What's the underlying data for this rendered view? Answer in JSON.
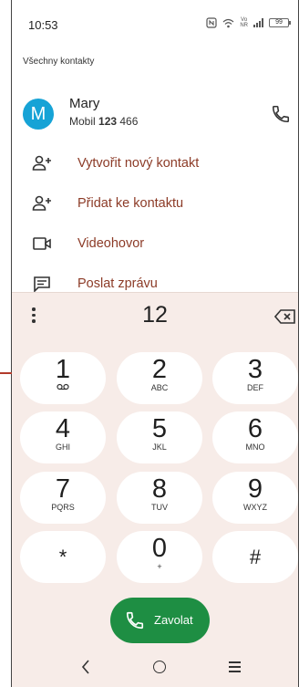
{
  "status": {
    "time": "10:53",
    "vo": "Vo",
    "nr": "NR",
    "battery": "99"
  },
  "contacts": {
    "section_label": "Všechny kontakty",
    "first_contact": {
      "initial": "M",
      "name": "Mary",
      "number_prefix": "Mobil ",
      "number_match": "123",
      "number_rest": " 466"
    }
  },
  "actions": [
    {
      "label": "Vytvořit nový kontakt",
      "icon": "add-person-icon"
    },
    {
      "label": "Přidat ke kontaktu",
      "icon": "add-person-icon"
    },
    {
      "label": "Videohovor",
      "icon": "video-icon"
    },
    {
      "label": "Poslat zprávu",
      "icon": "message-icon"
    }
  ],
  "dialpad": {
    "dialed_number": "12",
    "keys": [
      {
        "num": "1",
        "sub": "voicemail"
      },
      {
        "num": "2",
        "sub": "ABC"
      },
      {
        "num": "3",
        "sub": "DEF"
      },
      {
        "num": "4",
        "sub": "GHI"
      },
      {
        "num": "5",
        "sub": "JKL"
      },
      {
        "num": "6",
        "sub": "MNO"
      },
      {
        "num": "7",
        "sub": "PQRS"
      },
      {
        "num": "8",
        "sub": "TUV"
      },
      {
        "num": "9",
        "sub": "WXYZ"
      },
      {
        "num": "*",
        "sub": ""
      },
      {
        "num": "0",
        "sub": "+"
      },
      {
        "num": "#",
        "sub": ""
      }
    ],
    "call_label": "Zavolat"
  },
  "colors": {
    "accent": "#8c3b27",
    "call_green": "#1e8e43",
    "avatar": "#16a3d6",
    "dialpad_bg": "#f7ece8"
  }
}
